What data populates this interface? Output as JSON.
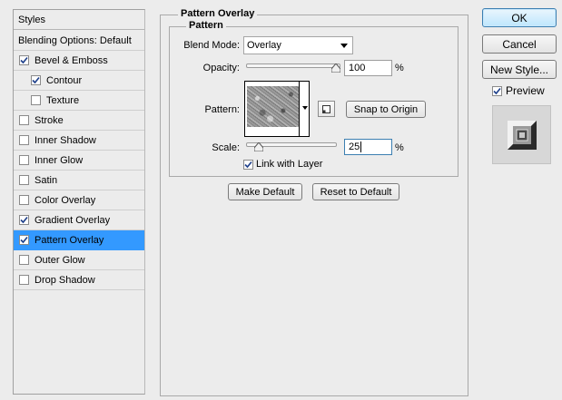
{
  "left_panel": {
    "header": "Styles",
    "blending_options": "Blending Options: Default",
    "items": [
      {
        "label": "Bevel & Emboss",
        "checked": true,
        "indent": false,
        "selected": false
      },
      {
        "label": "Contour",
        "checked": true,
        "indent": true,
        "selected": false
      },
      {
        "label": "Texture",
        "checked": false,
        "indent": true,
        "selected": false
      },
      {
        "label": "Stroke",
        "checked": false,
        "indent": false,
        "selected": false
      },
      {
        "label": "Inner Shadow",
        "checked": false,
        "indent": false,
        "selected": false
      },
      {
        "label": "Inner Glow",
        "checked": false,
        "indent": false,
        "selected": false
      },
      {
        "label": "Satin",
        "checked": false,
        "indent": false,
        "selected": false
      },
      {
        "label": "Color Overlay",
        "checked": false,
        "indent": false,
        "selected": false
      },
      {
        "label": "Gradient Overlay",
        "checked": true,
        "indent": false,
        "selected": false
      },
      {
        "label": "Pattern Overlay",
        "checked": true,
        "indent": false,
        "selected": true
      },
      {
        "label": "Outer Glow",
        "checked": false,
        "indent": false,
        "selected": false
      },
      {
        "label": "Drop Shadow",
        "checked": false,
        "indent": false,
        "selected": false
      }
    ]
  },
  "panel": {
    "group_title": "Pattern Overlay",
    "subgroup_title": "Pattern",
    "blend_mode_label": "Blend Mode:",
    "blend_mode_value": "Overlay",
    "opacity_label": "Opacity:",
    "opacity_value": "100",
    "opacity_fraction": 1.0,
    "opacity_unit": "%",
    "pattern_label": "Pattern:",
    "snap_button": "Snap to Origin",
    "scale_label": "Scale:",
    "scale_value": "25",
    "scale_fraction": 0.1,
    "scale_unit": "%",
    "link_label": "Link with Layer",
    "link_checked": true,
    "make_default_button": "Make Default",
    "reset_default_button": "Reset to Default"
  },
  "dialog_buttons": {
    "ok": "OK",
    "cancel": "Cancel",
    "new_style": "New Style...",
    "preview_label": "Preview",
    "preview_checked": true
  },
  "colors": {
    "selection": "#3399ff",
    "background": "#ececec"
  }
}
